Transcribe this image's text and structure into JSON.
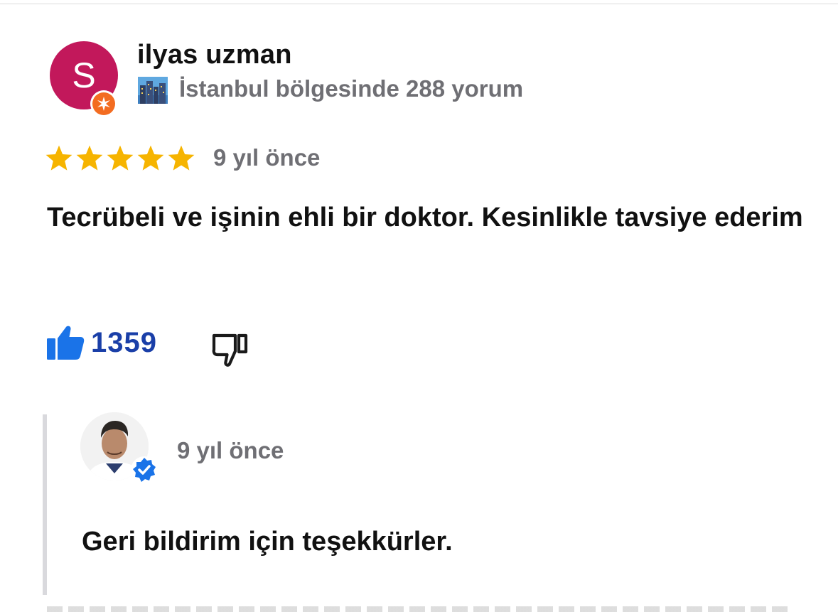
{
  "reviewer": {
    "avatar_letter": "S",
    "avatar_color": "#c2185b",
    "badge": "local-guide-badge-icon",
    "name": "ilyas uzman",
    "meta_icon": "city-buildings-icon",
    "meta": "İstanbul bölgesinde 288 yorum"
  },
  "review": {
    "rating": 5,
    "rating_max": 5,
    "star_color": "#f6b400",
    "time": "9 yıl önce",
    "text": "Tecrübeli ve işinin ehli bir doktor. Kesinlikle tavsiye ederim"
  },
  "reactions": {
    "like_icon": "thumbs-up-filled-icon",
    "like_count": "1359",
    "like_color": "#1a3fa8",
    "dislike_icon": "thumbs-down-outline-icon"
  },
  "owner_reply": {
    "avatar": "owner-photo",
    "verified_icon": "verified-check-icon",
    "verified_color": "#1a73e8",
    "time": "9 yıl önce",
    "text": "Geri bildirim için teşekkürler."
  }
}
